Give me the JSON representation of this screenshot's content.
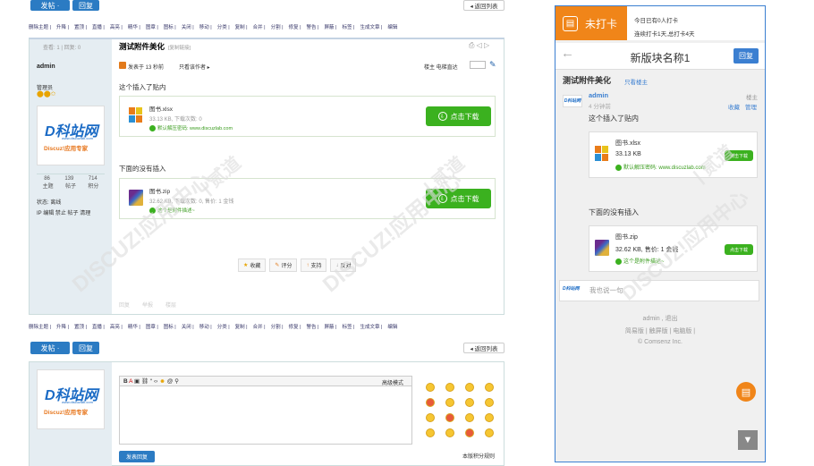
{
  "left": {
    "top_toolbar": {
      "post_btn": "发帖 ·",
      "reply_btn": "回复",
      "back_btn": "◂ 返回列表"
    },
    "mod_actions": [
      "删除主题",
      "升降",
      "置顶",
      "直播",
      "高亮",
      "精华",
      "图章",
      "图标",
      "关闭",
      "移动",
      "分类",
      "复制",
      "合并",
      "分割",
      "修复",
      "警告",
      "屏蔽",
      "标签",
      "生成文章",
      "编辑"
    ],
    "stats": "查看: 1 | 回复: 0",
    "thread_title": "测试附件美化",
    "copy_link": "[复制链接]",
    "author": {
      "name": "admin",
      "group": "管理员",
      "counts": [
        "86",
        "139",
        "714"
      ],
      "count_labels": [
        "主题",
        "帖子",
        "积分"
      ],
      "status": "状态: 离线",
      "admin_links": "IP 编辑 禁止 帖子 清理"
    },
    "post_meta": "发表于 13 秒前",
    "view_author": "只看该作者 ▸",
    "floor_info": "楼主  电梯直达",
    "body_text_1": "这个插入了贴内",
    "att1": {
      "name": "图书.xlsx",
      "info": "33.13 KB, 下载次数: 0",
      "pwd": "默认解压密码: www.discuzlab.com",
      "btn": "点击下载"
    },
    "body_text_2": "下面的没有插入",
    "att2": {
      "name": "图书.zip",
      "info": "32.62 KB, 下载次数: 0, 售价: 1 金钱",
      "pwd": "这个是附件描述~",
      "btn": "点击下载"
    },
    "actions": [
      "收藏",
      "评分",
      "支持",
      "反对"
    ],
    "bottom_links": [
      "回复",
      "举报",
      "楼层"
    ],
    "logo_big": "D科站网",
    "logo_small": "Discuz!应用专家",
    "logo_url": "www.discuzlab.com",
    "editor": {
      "mode": "高级模式",
      "submit": "发表回复",
      "rules": "本版积分规则"
    }
  },
  "mobile": {
    "checkin": {
      "label": "未打卡",
      "line1": "今日已有0人打卡",
      "line2": "连续打卡1天,总打卡4天"
    },
    "nav_title": "新版块名称1",
    "nav_reply": "回复",
    "thread_title": "测试附件美化",
    "only_author": "只看楼主",
    "author": "admin",
    "time": "4 分钟前",
    "floor": "楼主",
    "fav": "收藏",
    "manage": "管理",
    "text1": "这个插入了贴内",
    "att1": {
      "name": "图书.xlsx",
      "size": "33.13 KB",
      "pwd": "默认解压密码: www.discuzlab.com",
      "btn": "点击下载"
    },
    "text2": "下面的没有插入",
    "att2": {
      "name": "图书.zip",
      "size": "32.62 KB, 售价: 1 金钱",
      "pwd": "这个是附件描述~",
      "btn": "点击下载"
    },
    "reply_placeholder": "我也说一句",
    "footer_user": "admin , 退出",
    "footer_links": "简易版 | 触屏版 | 电脑版 |",
    "copyright": "© Comsenz Inc."
  },
  "watermark": "DISCUZ!应用中心 | 贰道 addon.dismall.com"
}
